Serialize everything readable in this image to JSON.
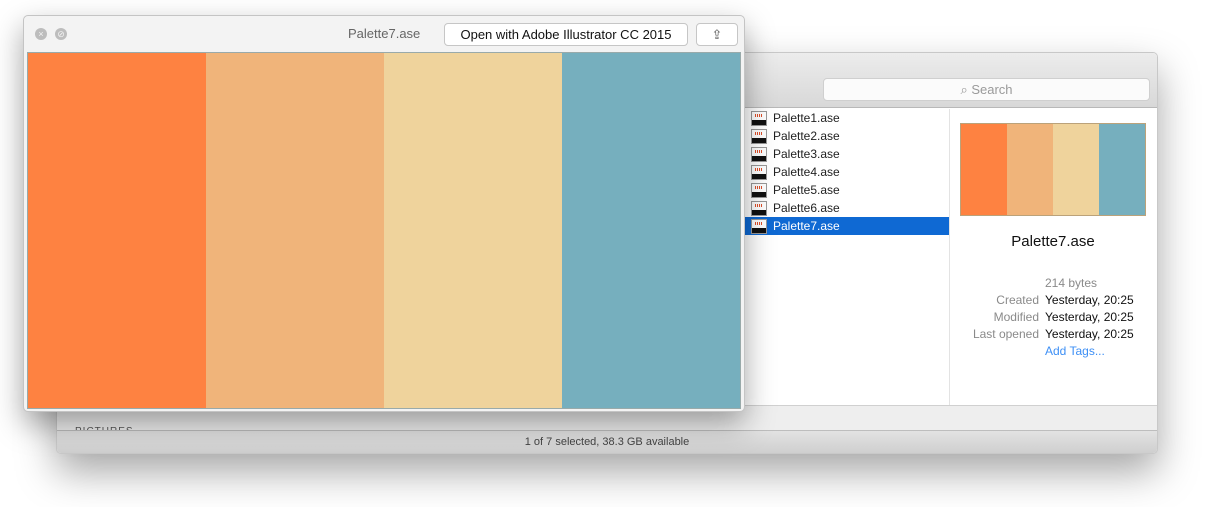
{
  "finder": {
    "search_placeholder": "Search",
    "files": [
      {
        "name": "Palette1.ase"
      },
      {
        "name": "Palette2.ase"
      },
      {
        "name": "Palette3.ase"
      },
      {
        "name": "Palette4.ase"
      },
      {
        "name": "Palette5.ase"
      },
      {
        "name": "Palette6.ase"
      },
      {
        "name": "Palette7.ase",
        "selected": true
      }
    ],
    "preview": {
      "name": "Palette7.ase",
      "size": "214 bytes",
      "created_label": "Created",
      "created": "Yesterday, 20:25",
      "modified_label": "Modified",
      "modified": "Yesterday, 20:25",
      "opened_label": "Last opened",
      "opened": "Yesterday, 20:25",
      "add_tags": "Add Tags..."
    },
    "sidebar_item": "PICTURES",
    "status": "1 of 7 selected, 38.3 GB available"
  },
  "quicklook": {
    "title": "Palette7.ase",
    "open_button": "Open with Adobe Illustrator CC 2015",
    "close_icon": "close-icon",
    "fullscreen_icon": "fullscreen-icon",
    "share_icon": "share-icon"
  },
  "palette_colors": [
    "#FE8241",
    "#F0B47A",
    "#EFD39C",
    "#76AFBE"
  ],
  "selection_color": "#0F69D3"
}
